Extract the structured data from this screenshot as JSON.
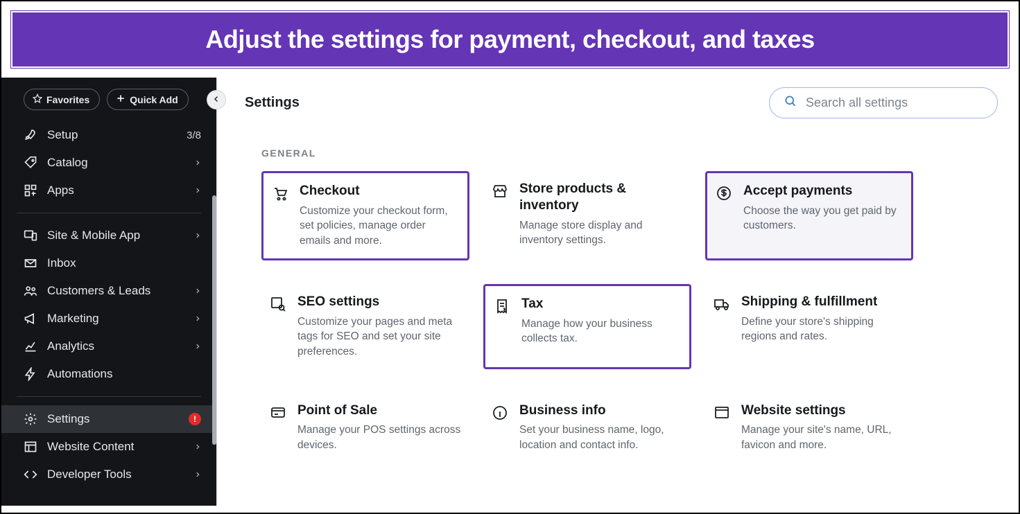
{
  "banner": {
    "text": "Adjust the settings for payment, checkout, and taxes"
  },
  "sidebar": {
    "favorites_label": "Favorites",
    "quick_add_label": "Quick Add",
    "items": [
      {
        "label": "Setup",
        "badge": "3/8"
      },
      {
        "label": "Catalog"
      },
      {
        "label": "Apps"
      },
      {
        "label": "Site & Mobile App"
      },
      {
        "label": "Inbox"
      },
      {
        "label": "Customers & Leads"
      },
      {
        "label": "Marketing"
      },
      {
        "label": "Analytics"
      },
      {
        "label": "Automations"
      },
      {
        "label": "Settings",
        "alert": "!"
      },
      {
        "label": "Website Content"
      },
      {
        "label": "Developer Tools"
      }
    ]
  },
  "main": {
    "title": "Settings",
    "search_placeholder": "Search all settings",
    "section_label": "GENERAL",
    "cards": [
      {
        "title": "Checkout",
        "desc": "Customize your checkout form, set policies, manage order emails and more."
      },
      {
        "title": "Store products & inventory",
        "desc": "Manage store display and inventory settings."
      },
      {
        "title": "Accept payments",
        "desc": "Choose the way you get paid by customers."
      },
      {
        "title": "SEO settings",
        "desc": "Customize your pages and meta tags for SEO and set your site preferences."
      },
      {
        "title": "Tax",
        "desc": "Manage how your business collects tax."
      },
      {
        "title": "Shipping & fulfillment",
        "desc": "Define your store's shipping regions and rates."
      },
      {
        "title": "Point of Sale",
        "desc": "Manage your POS settings across devices."
      },
      {
        "title": "Business info",
        "desc": "Set your business name, logo, location and contact info."
      },
      {
        "title": "Website settings",
        "desc": "Manage your site's name, URL, favicon and more."
      }
    ]
  }
}
